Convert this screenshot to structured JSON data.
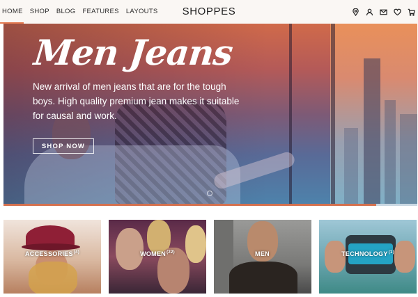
{
  "header": {
    "logo": "SHOPPES",
    "nav": [
      {
        "label": "HOME",
        "active": true
      },
      {
        "label": "SHOP"
      },
      {
        "label": "BLOG"
      },
      {
        "label": "FEATURES"
      },
      {
        "label": "LAYOUTS"
      }
    ],
    "icons": [
      "location-icon",
      "user-icon",
      "mail-icon",
      "heart-icon",
      "cart-icon"
    ]
  },
  "hero": {
    "title": "Men Jeans",
    "description": "New arrival of men jeans that are for the tough boys. High quality premium jean makes it suitable for causal and work.",
    "button": "SHOP NOW",
    "slide_progress": 0.9
  },
  "categories": [
    {
      "label": "ACCESSORIES",
      "count": "(4)"
    },
    {
      "label": "WOMEN",
      "count": "(22)"
    },
    {
      "label": "MEN",
      "count": ""
    },
    {
      "label": "TECHNOLOGY",
      "count": "(1)"
    }
  ],
  "colors": {
    "accent": "#e57b52",
    "hero_top": "#d06a4a",
    "hero_bottom": "#4d83ac"
  }
}
